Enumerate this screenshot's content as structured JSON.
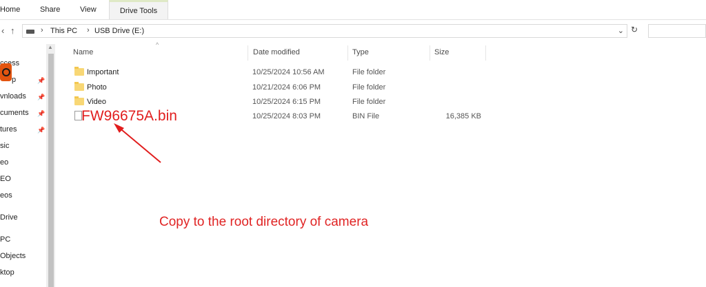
{
  "ribbon": {
    "tabs": [
      "Home",
      "Share",
      "View",
      "Drive Tools"
    ]
  },
  "address": {
    "back_icon": "chevron-left",
    "up_icon": "arrow-up",
    "crumbs": [
      "This PC",
      "USB Drive (E:)"
    ],
    "refresh_icon": "refresh"
  },
  "sidebar": {
    "items": [
      "ccess",
      "p",
      "vnloads",
      "cuments",
      "tures",
      "sic",
      "eo",
      "EO",
      "eos",
      "Drive",
      "PC",
      "Objects",
      "ktop"
    ]
  },
  "columns": {
    "name": "Name",
    "date": "Date modified",
    "type": "Type",
    "size": "Size"
  },
  "files": [
    {
      "name": "Important",
      "date": "10/25/2024 10:56 AM",
      "type": "File folder",
      "size": "",
      "icon": "folder"
    },
    {
      "name": "Photo",
      "date": "10/21/2024 6:06 PM",
      "type": "File folder",
      "size": "",
      "icon": "folder"
    },
    {
      "name": "Video",
      "date": "10/25/2024 6:15 PM",
      "type": "File folder",
      "size": "",
      "icon": "folder"
    },
    {
      "name": "",
      "date": "10/25/2024 8:03 PM",
      "type": "BIN File",
      "size": "16,385 KB",
      "icon": "file"
    }
  ],
  "annotations": {
    "file_label": "FW96675A.bin",
    "instruction": "Copy to the root directory of camera",
    "color": "#e11d1d"
  }
}
